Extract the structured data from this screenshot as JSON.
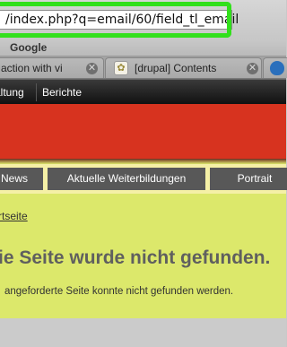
{
  "browser": {
    "address_bar": {
      "url_text": "/index.php?q=email/60/field_tl_email"
    },
    "bookmarks": [
      {
        "label": "Google"
      }
    ],
    "tabs": [
      {
        "title": "action with vi",
        "close": "✕"
      },
      {
        "title": "[drupal] Contents",
        "close": "✕"
      },
      {
        "title": ""
      }
    ]
  },
  "site": {
    "admin_menu": [
      {
        "label": "altung"
      },
      {
        "label": "Berichte"
      }
    ],
    "primary_menu": [
      {
        "label": "News"
      },
      {
        "label": "Aktuelle Weiterbildungen"
      },
      {
        "label": "Portrait"
      }
    ],
    "breadcrumb": "rtseite",
    "page_title": "ie Seite wurde nicht gefunden.",
    "message": "angeforderte Seite konnte nicht gefunden werden."
  },
  "colors": {
    "highlight": "#32e01c",
    "header_red": "#d7331f",
    "page_background": "#dce86b",
    "menu_item": "#585858"
  }
}
